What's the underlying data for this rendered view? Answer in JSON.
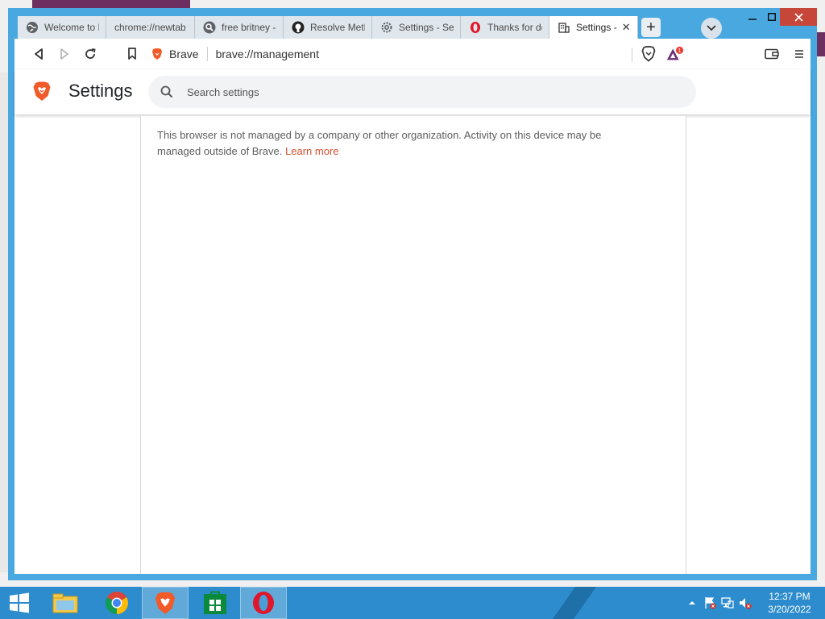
{
  "tabs": [
    {
      "title": "Welcome to B",
      "icon": "globe-icon",
      "active": false
    },
    {
      "title": "chrome://newtab",
      "icon": "",
      "active": false
    },
    {
      "title": "free britney -",
      "icon": "search-icon",
      "active": false
    },
    {
      "title": "Resolve Meth",
      "icon": "github-icon",
      "active": false
    },
    {
      "title": "Settings - Sec",
      "icon": "gear-icon",
      "active": false
    },
    {
      "title": "Thanks for do",
      "icon": "opera-icon",
      "active": false
    },
    {
      "title": "Settings -",
      "icon": "building-icon",
      "active": true
    }
  ],
  "toolbar": {
    "site_chip_label": "Brave",
    "url": "brave://management"
  },
  "settings": {
    "title": "Settings",
    "search_placeholder": "Search settings"
  },
  "management": {
    "message": "This browser is not managed by a company or other organization. Activity on this device may be managed outside of Brave.",
    "learn_more": "Learn more"
  },
  "taskbar": {
    "apps": [
      "file-explorer-icon",
      "chrome-icon",
      "brave-icon",
      "store-icon",
      "opera-icon"
    ],
    "active_app": "brave-icon"
  },
  "clock": {
    "time": "12:37 PM",
    "date": "3/20/2022"
  },
  "colors": {
    "window_frame": "#4aa8e0",
    "taskbar": "#2d8ccd",
    "accent_link": "#d8502f",
    "close_button": "#c7463a"
  }
}
